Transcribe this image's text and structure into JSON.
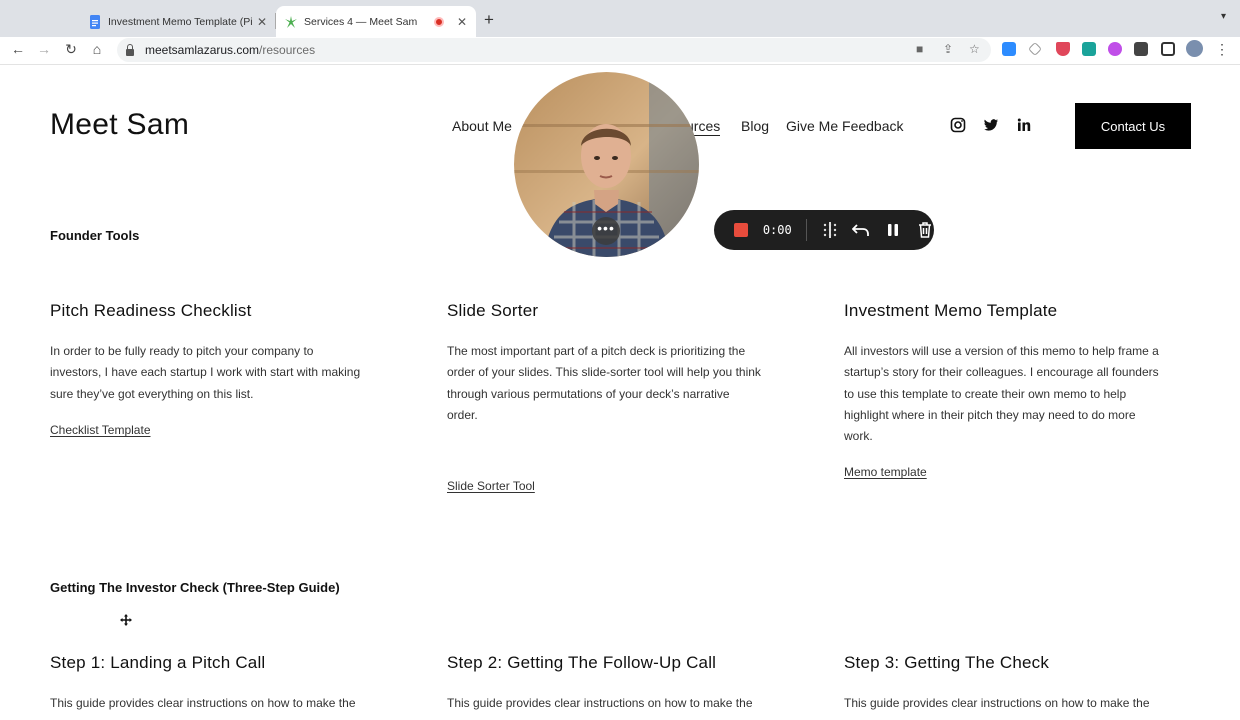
{
  "browser": {
    "tabs": [
      {
        "title": "Investment Memo Template (Pi"
      },
      {
        "title": "Services 4 — Meet Sam"
      }
    ],
    "url_host": "meetsamlazarus.com",
    "url_path": "/resources"
  },
  "site": {
    "logo": "Meet Sam",
    "nav": [
      "About Me",
      "Resources",
      "Blog",
      "Give Me Feedback"
    ],
    "nav_visible_resources": "urces",
    "contact_label": "Contact Us"
  },
  "recording": {
    "time": "0:00"
  },
  "founder_tools": {
    "heading": "Founder Tools",
    "cards": [
      {
        "title": "Pitch Readiness Checklist",
        "lines": [
          "In order to be fully ready to pitch your company to",
          "investors, I have each startup I work with start with making",
          "sure they’ve got everything on this list."
        ],
        "link": "Checklist Template"
      },
      {
        "title": "Slide Sorter",
        "lines": [
          "The most important part of a pitch deck is prioritizing the",
          "order of your slides. This slide-sorter tool will help you think",
          "through various permutations of your deck’s narrative",
          "order."
        ],
        "link": "Slide Sorter Tool"
      },
      {
        "title": "Investment Memo Template",
        "lines": [
          "All investors will use a version of this memo to help frame a",
          "startup’s story for their colleagues. I encourage all founders",
          "to use this template to create their own memo to help",
          "highlight where in their pitch they may need to do more",
          "work."
        ],
        "link": "Memo template"
      }
    ]
  },
  "investor_check": {
    "heading": "Getting The Investor Check (Three-Step Guide)",
    "steps": [
      {
        "title": "Step 1: Landing a Pitch Call",
        "text": "This guide provides clear instructions on how to make the"
      },
      {
        "title": "Step 2: Getting The Follow-Up Call",
        "text": "This guide provides clear instructions on how to make the"
      },
      {
        "title": "Step 3: Getting The Check",
        "text": "This guide provides clear instructions on how to make the"
      }
    ]
  }
}
